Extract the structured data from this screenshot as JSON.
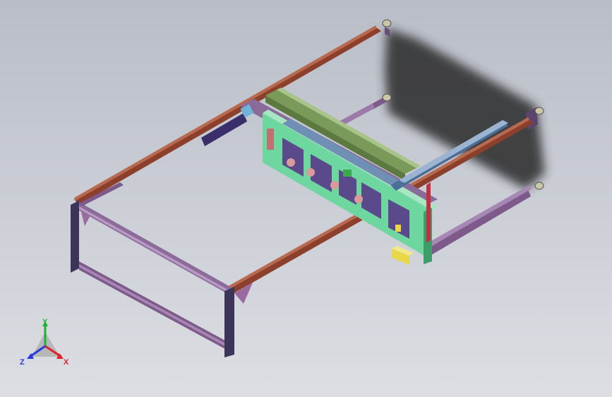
{
  "viewport": {
    "background_top": "#b9bdc7",
    "background_bottom": "#dcdee3"
  },
  "colors": {
    "frame_rail": "#8c3f2a",
    "frame_rail_light": "#b76a50",
    "profile_purple": "#7d5a8a",
    "profile_purple_light": "#a788b4",
    "profile_dark": "#3c3557",
    "panel_green": "#6ed7a0",
    "panel_mint": "#a6e6c2",
    "beam_blue": "#6f8fb5",
    "rail_green": "#7a9a5a",
    "shadow": "#2a2a2a",
    "bracket_yellow": "#e8d84a",
    "leveling_foot": "#c8c8a8"
  },
  "triad": {
    "x_label": "X",
    "y_label": "Y",
    "z_label": "Z",
    "x_color": "#e0202a",
    "y_color": "#1fb038",
    "z_color": "#2a3ad8"
  }
}
